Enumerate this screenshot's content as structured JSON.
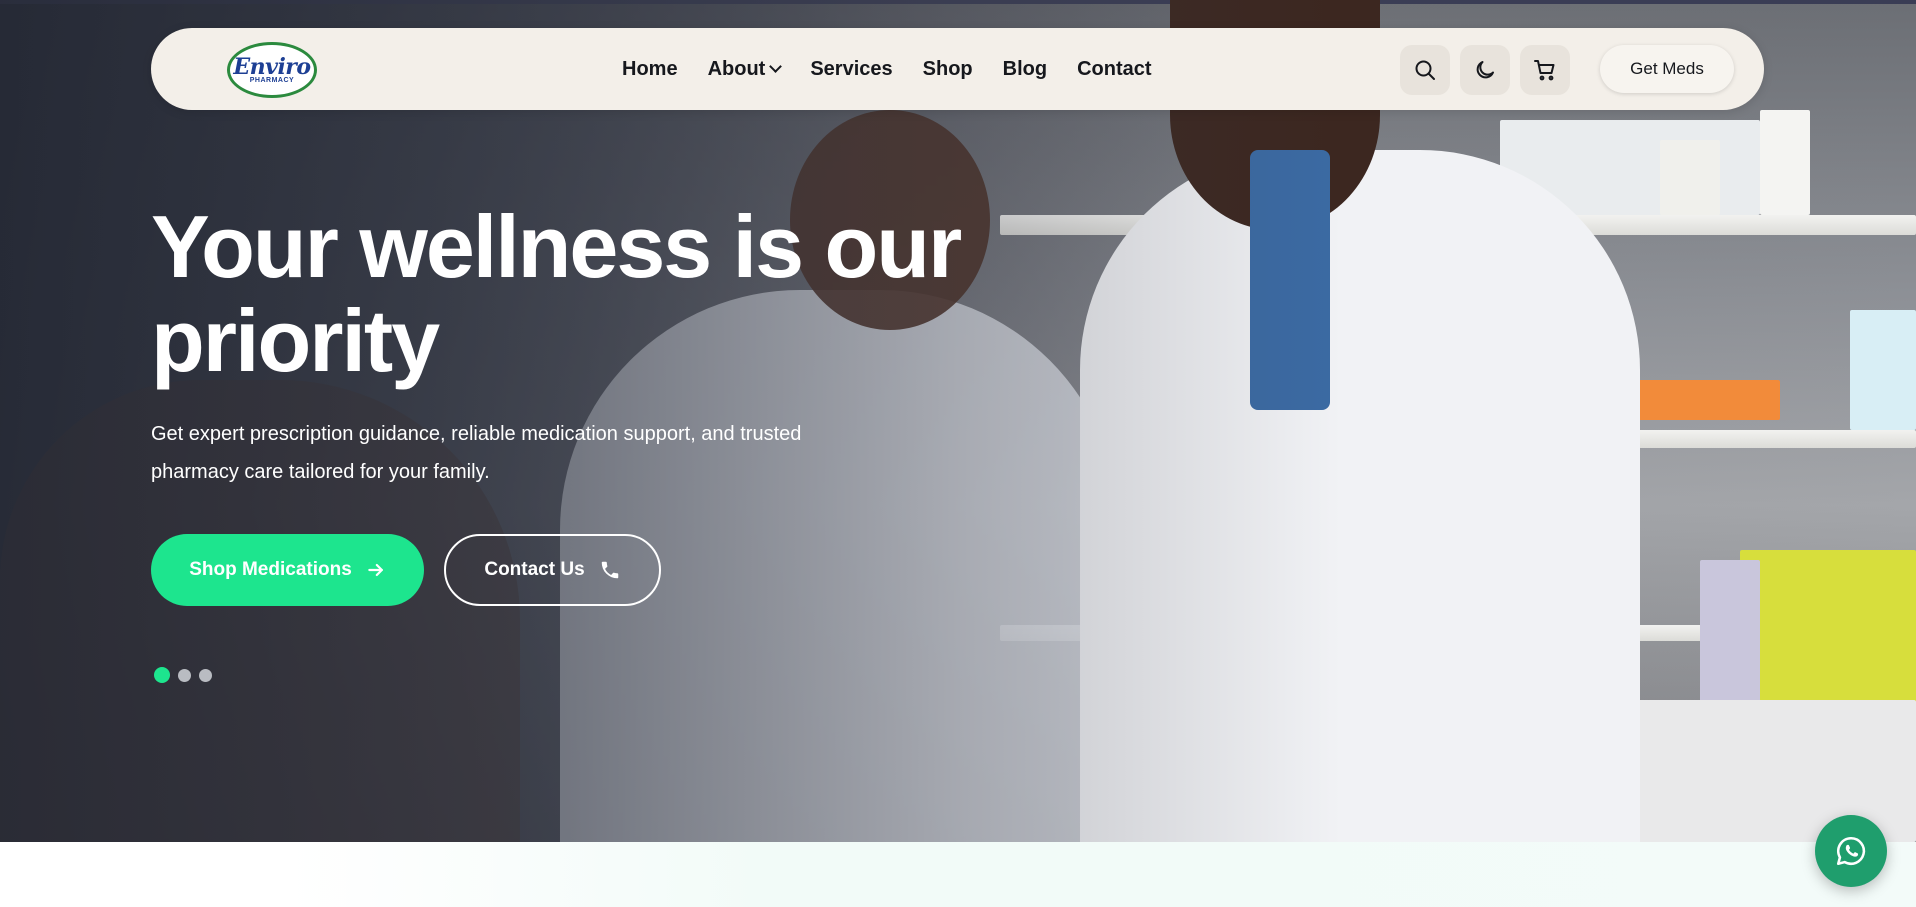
{
  "brand": {
    "logo_text": "Enviro",
    "logo_subtext": "PHARMACY"
  },
  "nav": {
    "items": [
      {
        "label": "Home"
      },
      {
        "label": "About"
      },
      {
        "label": "Services"
      },
      {
        "label": "Shop"
      },
      {
        "label": "Blog"
      },
      {
        "label": "Contact"
      }
    ],
    "icons": [
      "search-icon",
      "moon-icon",
      "cart-icon"
    ],
    "cta_label": "Get Meds"
  },
  "hero": {
    "headline": "Your wellness is our priority",
    "subtext": "Get expert prescription guidance, reliable medication support, and trusted pharmacy care tailored for your family.",
    "primary_button": "Shop Medications",
    "secondary_button": "Contact Us",
    "slides_total": 3,
    "active_slide": 1
  },
  "colors": {
    "accent": "#1de58e",
    "nav_bg": "#f3efe9",
    "whatsapp": "#1f9e6d",
    "logo_blue": "#1d3f94",
    "logo_green": "#2b8a3e"
  }
}
